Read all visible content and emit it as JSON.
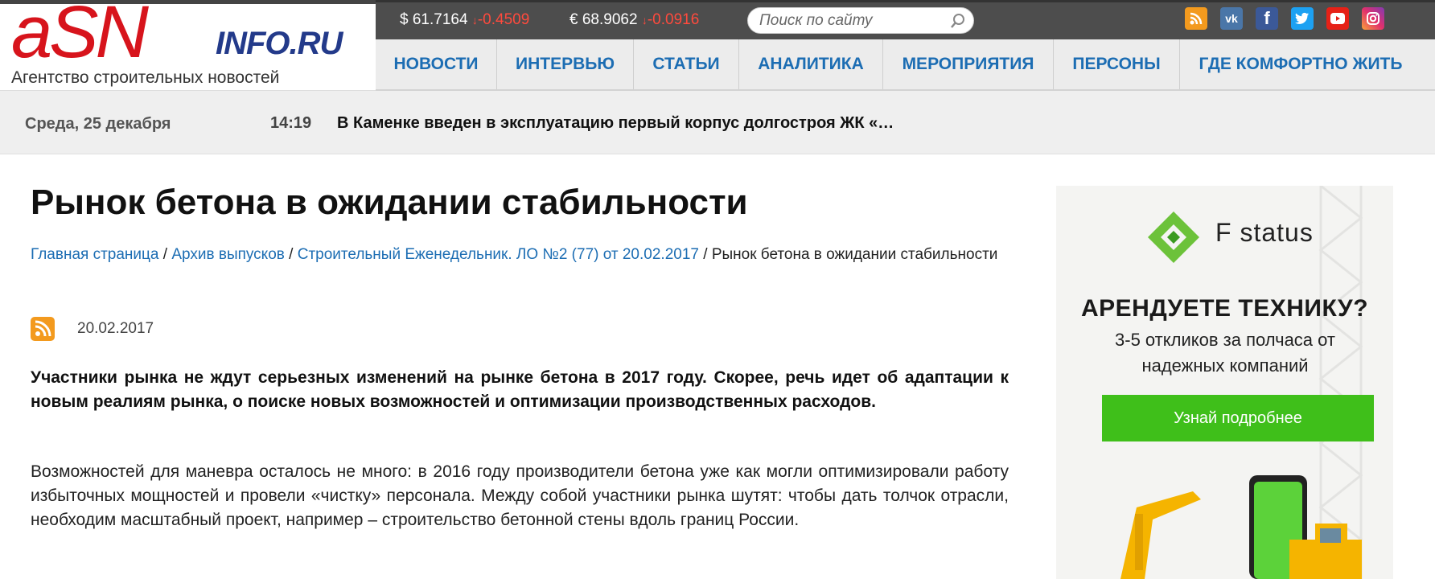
{
  "header": {
    "logo": {
      "main": "aSN",
      "suffix": "INFO.RU",
      "tagline": "Агентство строительных новостей"
    },
    "rates": [
      {
        "symbol": "$",
        "value": "61.7164",
        "arrow": "↓",
        "change": "-0.4509"
      },
      {
        "symbol": "€",
        "value": "68.9062",
        "arrow": "↓",
        "change": "-0.0916"
      }
    ],
    "search": {
      "placeholder": "Поиск по сайту"
    },
    "social": [
      {
        "name": "rss-icon",
        "glyph": "◉",
        "color": "#f39a1e"
      },
      {
        "name": "vk-icon",
        "glyph": "vk",
        "color": "#4a76a8"
      },
      {
        "name": "facebook-icon",
        "glyph": "f",
        "color": "#3b5998"
      },
      {
        "name": "twitter-icon",
        "glyph": "t",
        "color": "#1da1f2"
      },
      {
        "name": "youtube-icon",
        "glyph": "▶",
        "color": "#e62117"
      },
      {
        "name": "instagram-icon",
        "glyph": "◎",
        "color": "#c13584"
      }
    ]
  },
  "nav": {
    "items": [
      "НОВОСТИ",
      "ИНТЕРВЬЮ",
      "СТАТЬИ",
      "АНАЛИТИКА",
      "МЕРОПРИЯТИЯ",
      "ПЕРСОНЫ",
      "ГДЕ КОМФОРТНО ЖИТЬ"
    ]
  },
  "ticker": {
    "date": "Среда, 25 декабря",
    "time": "14:19",
    "headline": "В Каменке введен в эксплуатацию первый корпус долгостроя ЖК «…"
  },
  "article": {
    "title": "Рынок бетона в ожидании стабильности",
    "breadcrumbs": [
      "Главная страница",
      "Архив выпусков",
      "Строительный Еженедельник. ЛО №2 (77) от 20.02.2017"
    ],
    "breadcrumb_sep": " / ",
    "breadcrumb_current": "Рынок бетона в ожидании стабильности",
    "date": "20.02.2017",
    "lead": "Участники рынка не ждут серьезных изменений на рынке бетона в 2017 году. Скорее, речь идет об адаптации к новым реалиям рынка, о поиске новых возможностей и оптимизации производственных расходов.",
    "paragraph": "Возможностей для маневра осталось не много: в 2016 году производители бетона уже как могли оптимизировали работу избыточных мощностей и провели «чистку» персонала. Между собой участники рынка шутят: чтобы дать толчок отрасли, необходим масштабный проект, например – строительство бетонной стены вдоль границ России."
  },
  "ad": {
    "brand": "F status",
    "headline": "АРЕНДУЕТЕ ТЕХНИКУ?",
    "sub": "3-5 откликов за полчаса от надежных компаний",
    "button": "Узнай подробнее",
    "colors": {
      "green": "#3fbf1a"
    }
  },
  "colors": {
    "brand_red": "#d7141c",
    "link_blue": "#1c6db3",
    "topbar": "#4d4d4d",
    "down_red": "#ff4a3d"
  }
}
